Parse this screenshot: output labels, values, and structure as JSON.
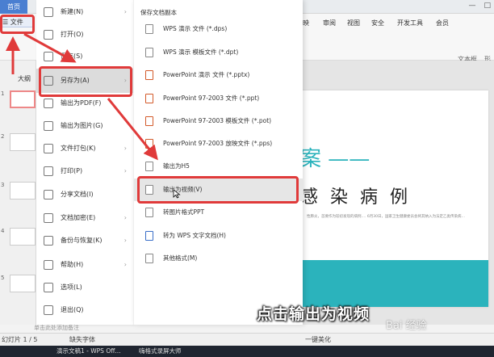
{
  "window": {
    "home_tab": "首页"
  },
  "ribbon": {
    "file_button": "☰ 文件",
    "tab_slideshow": "映",
    "tab_review": "审阅",
    "tab_view": "视图",
    "tab_security": "安全",
    "tab_dev": "开发工具",
    "tab_vip": "会员",
    "tab_textbox": "文本框",
    "tab_shape": "形"
  },
  "left_panel": {
    "outline_tab": "大纲",
    "slides": [
      "1",
      "2",
      "3",
      "4",
      "5"
    ]
  },
  "file_menu": {
    "items": [
      {
        "label": "新建(N)",
        "arrow": "›"
      },
      {
        "label": "打开(O)",
        "arrow": ""
      },
      {
        "label": "保存(S)",
        "arrow": ""
      },
      {
        "label": "另存为(A)",
        "arrow": "›"
      },
      {
        "label": "输出为PDF(F)",
        "arrow": ""
      },
      {
        "label": "输出为图片(G)",
        "arrow": ""
      },
      {
        "label": "文件打包(K)",
        "arrow": "›"
      },
      {
        "label": "打印(P)",
        "arrow": "›"
      },
      {
        "label": "分享文档(I)",
        "arrow": ""
      },
      {
        "label": "文档加密(E)",
        "arrow": "›"
      },
      {
        "label": "备份与恢复(K)",
        "arrow": "›"
      },
      {
        "label": "帮助(H)",
        "arrow": "›"
      },
      {
        "label": "选项(L)",
        "arrow": ""
      },
      {
        "label": "退出(Q)",
        "arrow": ""
      }
    ]
  },
  "save_as_panel": {
    "title": "保存文档副本",
    "items": [
      "WPS 演示 文件 (*.dps)",
      "WPS 演示 模板文件 (*.dpt)",
      "PowerPoint 演示 文件 (*.pptx)",
      "PowerPoint 97-2003 文件 (*.ppt)",
      "PowerPoint 97-2003 模板文件 (*.pot)",
      "PowerPoint 97-2003 放映文件 (*.pps)",
      "输出为H5",
      "输出为视频(V)",
      "转图片格式PPT",
      "转为 WPS 文字文档(H)",
      "其他格式(M)"
    ]
  },
  "slide": {
    "title_1": "案 ——",
    "title_2": "感 染 病 例",
    "body": "性肺炎，首要作为较初发现的病例.… 6月30日，国家卫生健康委员会将其纳入为法定乙类传染病…"
  },
  "status": {
    "slide_info": "幻灯片 1 / 5",
    "missing_font": "缺失字体",
    "beautify": "一键美化",
    "notes": "单击此处添加备注"
  },
  "taskbar": {
    "app1": "演示文稿1 - WPS Off...",
    "app2": "嗨格式录屏大师"
  },
  "caption": "点击输出为视频",
  "watermark": "Bai 经验"
}
